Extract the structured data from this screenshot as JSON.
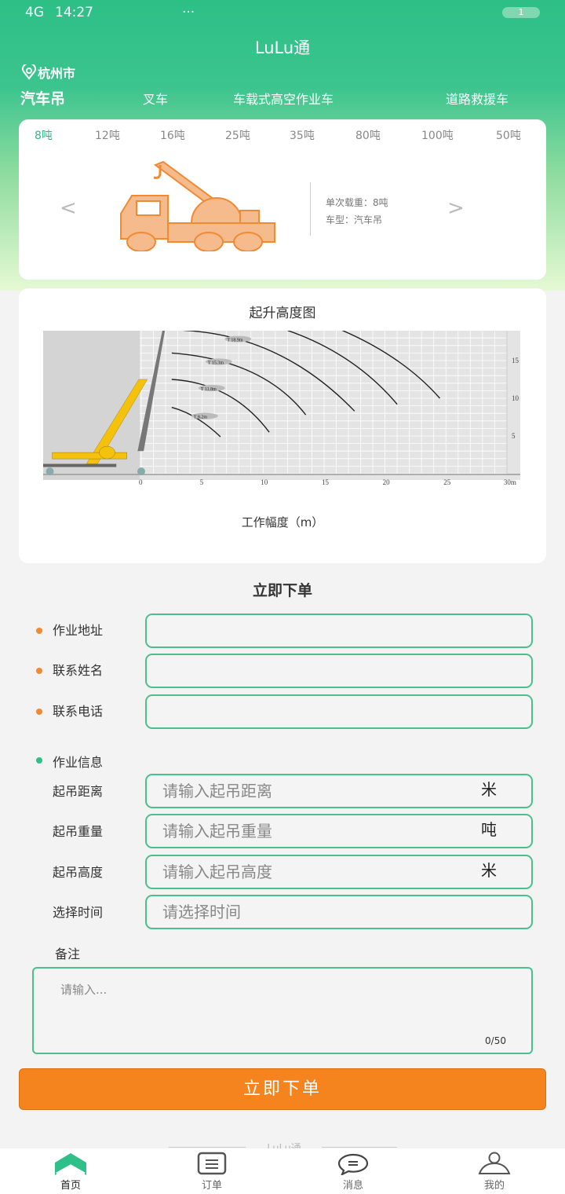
{
  "status_bar": {
    "network": "4G",
    "time": "14:27",
    "more": "···",
    "battery": "1"
  },
  "header": {
    "title": "LuLu通",
    "location": "杭州市"
  },
  "categories": [
    "汽车吊",
    "叉车",
    "车载式高空作业车",
    "道路救援车"
  ],
  "tonnages": [
    "8吨",
    "12吨",
    "16吨",
    "25吨",
    "35吨",
    "80吨",
    "100吨",
    "50吨"
  ],
  "vehicle": {
    "load": "单次载重：8吨",
    "type": "车型：汽车吊"
  },
  "lift_chart": {
    "title": "起升高度图",
    "xlabel": "工作幅度（m）",
    "x_ticks": [
      "0",
      "5",
      "10",
      "15",
      "20",
      "25",
      "30m"
    ],
    "y_ticks": [
      "5",
      "10",
      "15"
    ],
    "xlim": [
      0,
      30
    ],
    "ylim": [
      0,
      19
    ],
    "curves": [
      {
        "label": "T 8.2m",
        "points": [
          [
            2.5,
            8.8
          ],
          [
            4.5,
            7.4
          ],
          [
            6.5,
            4.9
          ]
        ]
      },
      {
        "label": "T 11.8m",
        "points": [
          [
            2.5,
            12.5
          ],
          [
            7,
            10.5
          ],
          [
            10.5,
            5.5
          ]
        ]
      },
      {
        "label": "T 15.3m",
        "points": [
          [
            2.5,
            16
          ],
          [
            9,
            13.5
          ],
          [
            13.5,
            7.8
          ]
        ]
      },
      {
        "label": "T 18.9m",
        "points": [
          [
            3.5,
            19
          ],
          [
            11,
            16
          ],
          [
            17.5,
            8.3
          ]
        ]
      },
      {
        "label": "",
        "points": [
          [
            12,
            19
          ],
          [
            17,
            15
          ],
          [
            21,
            9.2
          ]
        ]
      },
      {
        "label": "",
        "points": [
          [
            16.5,
            19
          ],
          [
            21,
            15
          ],
          [
            24.5,
            10
          ]
        ]
      }
    ]
  },
  "form": {
    "title": "立即下单",
    "contact": [
      {
        "label": "作业地址"
      },
      {
        "label": "联系姓名"
      },
      {
        "label": "联系电话"
      }
    ],
    "work_info_label": "作业信息",
    "work": [
      {
        "label": "起吊距离",
        "placeholder": "请输入起吊距离",
        "unit": "米"
      },
      {
        "label": "起吊重量",
        "placeholder": "请输入起吊重量",
        "unit": "吨"
      },
      {
        "label": "起吊高度",
        "placeholder": "请输入起吊高度",
        "unit": "米"
      },
      {
        "label": "选择时间",
        "placeholder": "请选择时间",
        "unit": ""
      }
    ],
    "remark_label": "备注",
    "remark_placeholder": "请输入...",
    "remark_count": "0/50",
    "submit": "立即下单"
  },
  "footer_brand": "LuLu通",
  "tabbar": [
    {
      "label": "首页",
      "icon": "home-icon"
    },
    {
      "label": "订单",
      "icon": "order-icon"
    },
    {
      "label": "消息",
      "icon": "message-icon"
    },
    {
      "label": "我的",
      "icon": "user-icon"
    }
  ],
  "colors": {
    "primary": "#2fbf88",
    "accent": "#f5841f"
  }
}
